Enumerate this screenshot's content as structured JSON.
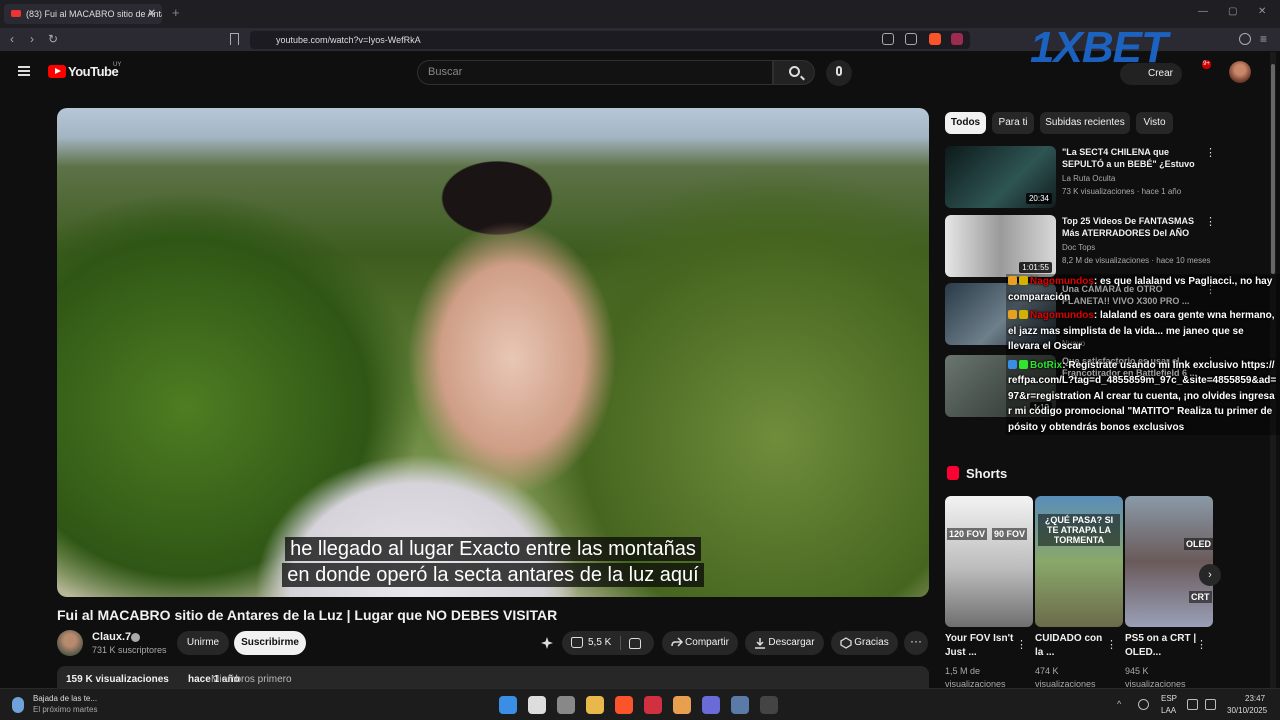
{
  "browser": {
    "tab_title": "(83) Fui al MACABRO sitio de Antares",
    "tab_close": "✕",
    "new_tab": "+",
    "url": "youtube.com/watch?v=Iyos-WefRkA"
  },
  "youtube": {
    "logo_text": "YouTube",
    "country": "UY",
    "search_placeholder": "Buscar",
    "create_label": "Crear",
    "notif_count": "9+"
  },
  "video": {
    "subtitle_line1": "he llegado al lugar Exacto entre las montañas",
    "subtitle_line2": "en donde operó la secta antares de la luz aquí",
    "title": "Fui al MACABRO sitio de Antares de la Luz | Lugar que NO DEBES VISITAR",
    "channel": "Claux.7",
    "subscribers": "731 K suscriptores",
    "join_label": "Unirme",
    "subscribe_label": "Suscribirme",
    "likes": "5,5 K",
    "share_label": "Compartir",
    "download_label": "Descargar",
    "thanks_label": "Gracias",
    "more_label": "···",
    "views": "159 K visualizaciones",
    "ago": "hace 1 año",
    "members": "Miembros primero"
  },
  "sidebar": {
    "chips": [
      "Todos",
      "Para ti",
      "Subidas recientes",
      "Visto"
    ],
    "recommendations": [
      {
        "title": "\"La SECT4 CHILENA que SEPULTÓ a un BEBÉ\" ¿Estuvo ...",
        "channel": "La Ruta Oculta",
        "meta": "73 K visualizaciones · hace 1 año",
        "duration": "20:34",
        "thumb_color": "#1f3b3a"
      },
      {
        "title": "Top 25 Videos De FANTASMAS Más ATERRADORES Del AÑO",
        "channel": "Doc Tops",
        "meta": "8,2 M de visualizaciones · hace 10 meses",
        "duration": "1:01:55",
        "thumb_color": "#cfcfcf"
      },
      {
        "title": "Una CÁMARA de OTRO PLANETA!! VIVO X300 PRO ...",
        "channel": "",
        "meta": "Nuevo",
        "duration": "",
        "thumb_color": "#3a4a55"
      },
      {
        "title": "Que satisfactorio es usar el Francotirador en Battlefield 6 ...",
        "channel": "",
        "meta": "",
        "duration": "1:12",
        "thumb_color": "#56605a"
      }
    ],
    "shorts_title": "Shorts",
    "shorts": [
      {
        "title": "Your FOV Isn't Just ...",
        "views": "1,5 M de visualizaciones",
        "label_a": "120 FOV",
        "label_b": "90 FOV"
      },
      {
        "title": "CUIDADO con la ...",
        "views": "474 K visualizaciones",
        "label_a": "¿QUÉ PASA? SI TE ATRAPA LA TORMENTA",
        "label_b": ""
      },
      {
        "title": "PS5 on a CRT | OLED...",
        "views": "945 K visualizaciones",
        "label_a": "OLED",
        "label_b": "CRT"
      }
    ],
    "shorts_next": "›"
  },
  "chat": [
    {
      "user": "Nagomundos",
      "user_color": "red",
      "text": ": es que lalaland vs Pagliacci., no hay comparación"
    },
    {
      "user": "Nagomundos",
      "user_color": "red",
      "text": ": lalaland es oara gente wna hermano, el jazz mas simplista de la vida... me janeo que se llevara el Oscar"
    },
    {
      "user": "BotRix",
      "user_color": "green",
      "text": ": Regístrate usando mi link exclusivo https://reffpa.com/L?tag=d_4855859m_97c_&site=4855859&ad=97&r=registration Al crear tu cuenta, ¡no olvides ingresar mi código promocional \"MATITO\" Realiza tu primer depósito y obtendrás bonos exclusivos"
    }
  ],
  "watermark": "1XBET",
  "taskbar": {
    "download_title": "Bajada de las te...",
    "download_sub": "El próximo martes",
    "lang1": "ESP",
    "lang2": "LAA",
    "time": "23:47",
    "date": "30/10/2025",
    "app_colors": [
      "#3a8ee6",
      "#dddddd",
      "#888888",
      "#e8b84a",
      "#fb542b",
      "#d03040",
      "#e8a050",
      "#6b6bd8",
      "#5a7aa8",
      "#444444"
    ]
  },
  "colors": {
    "youtube_red": "#ff0000",
    "background": "#0f0f0f",
    "chip_active": "#f1f1f1",
    "watermark_blue": "#1b66c9"
  }
}
